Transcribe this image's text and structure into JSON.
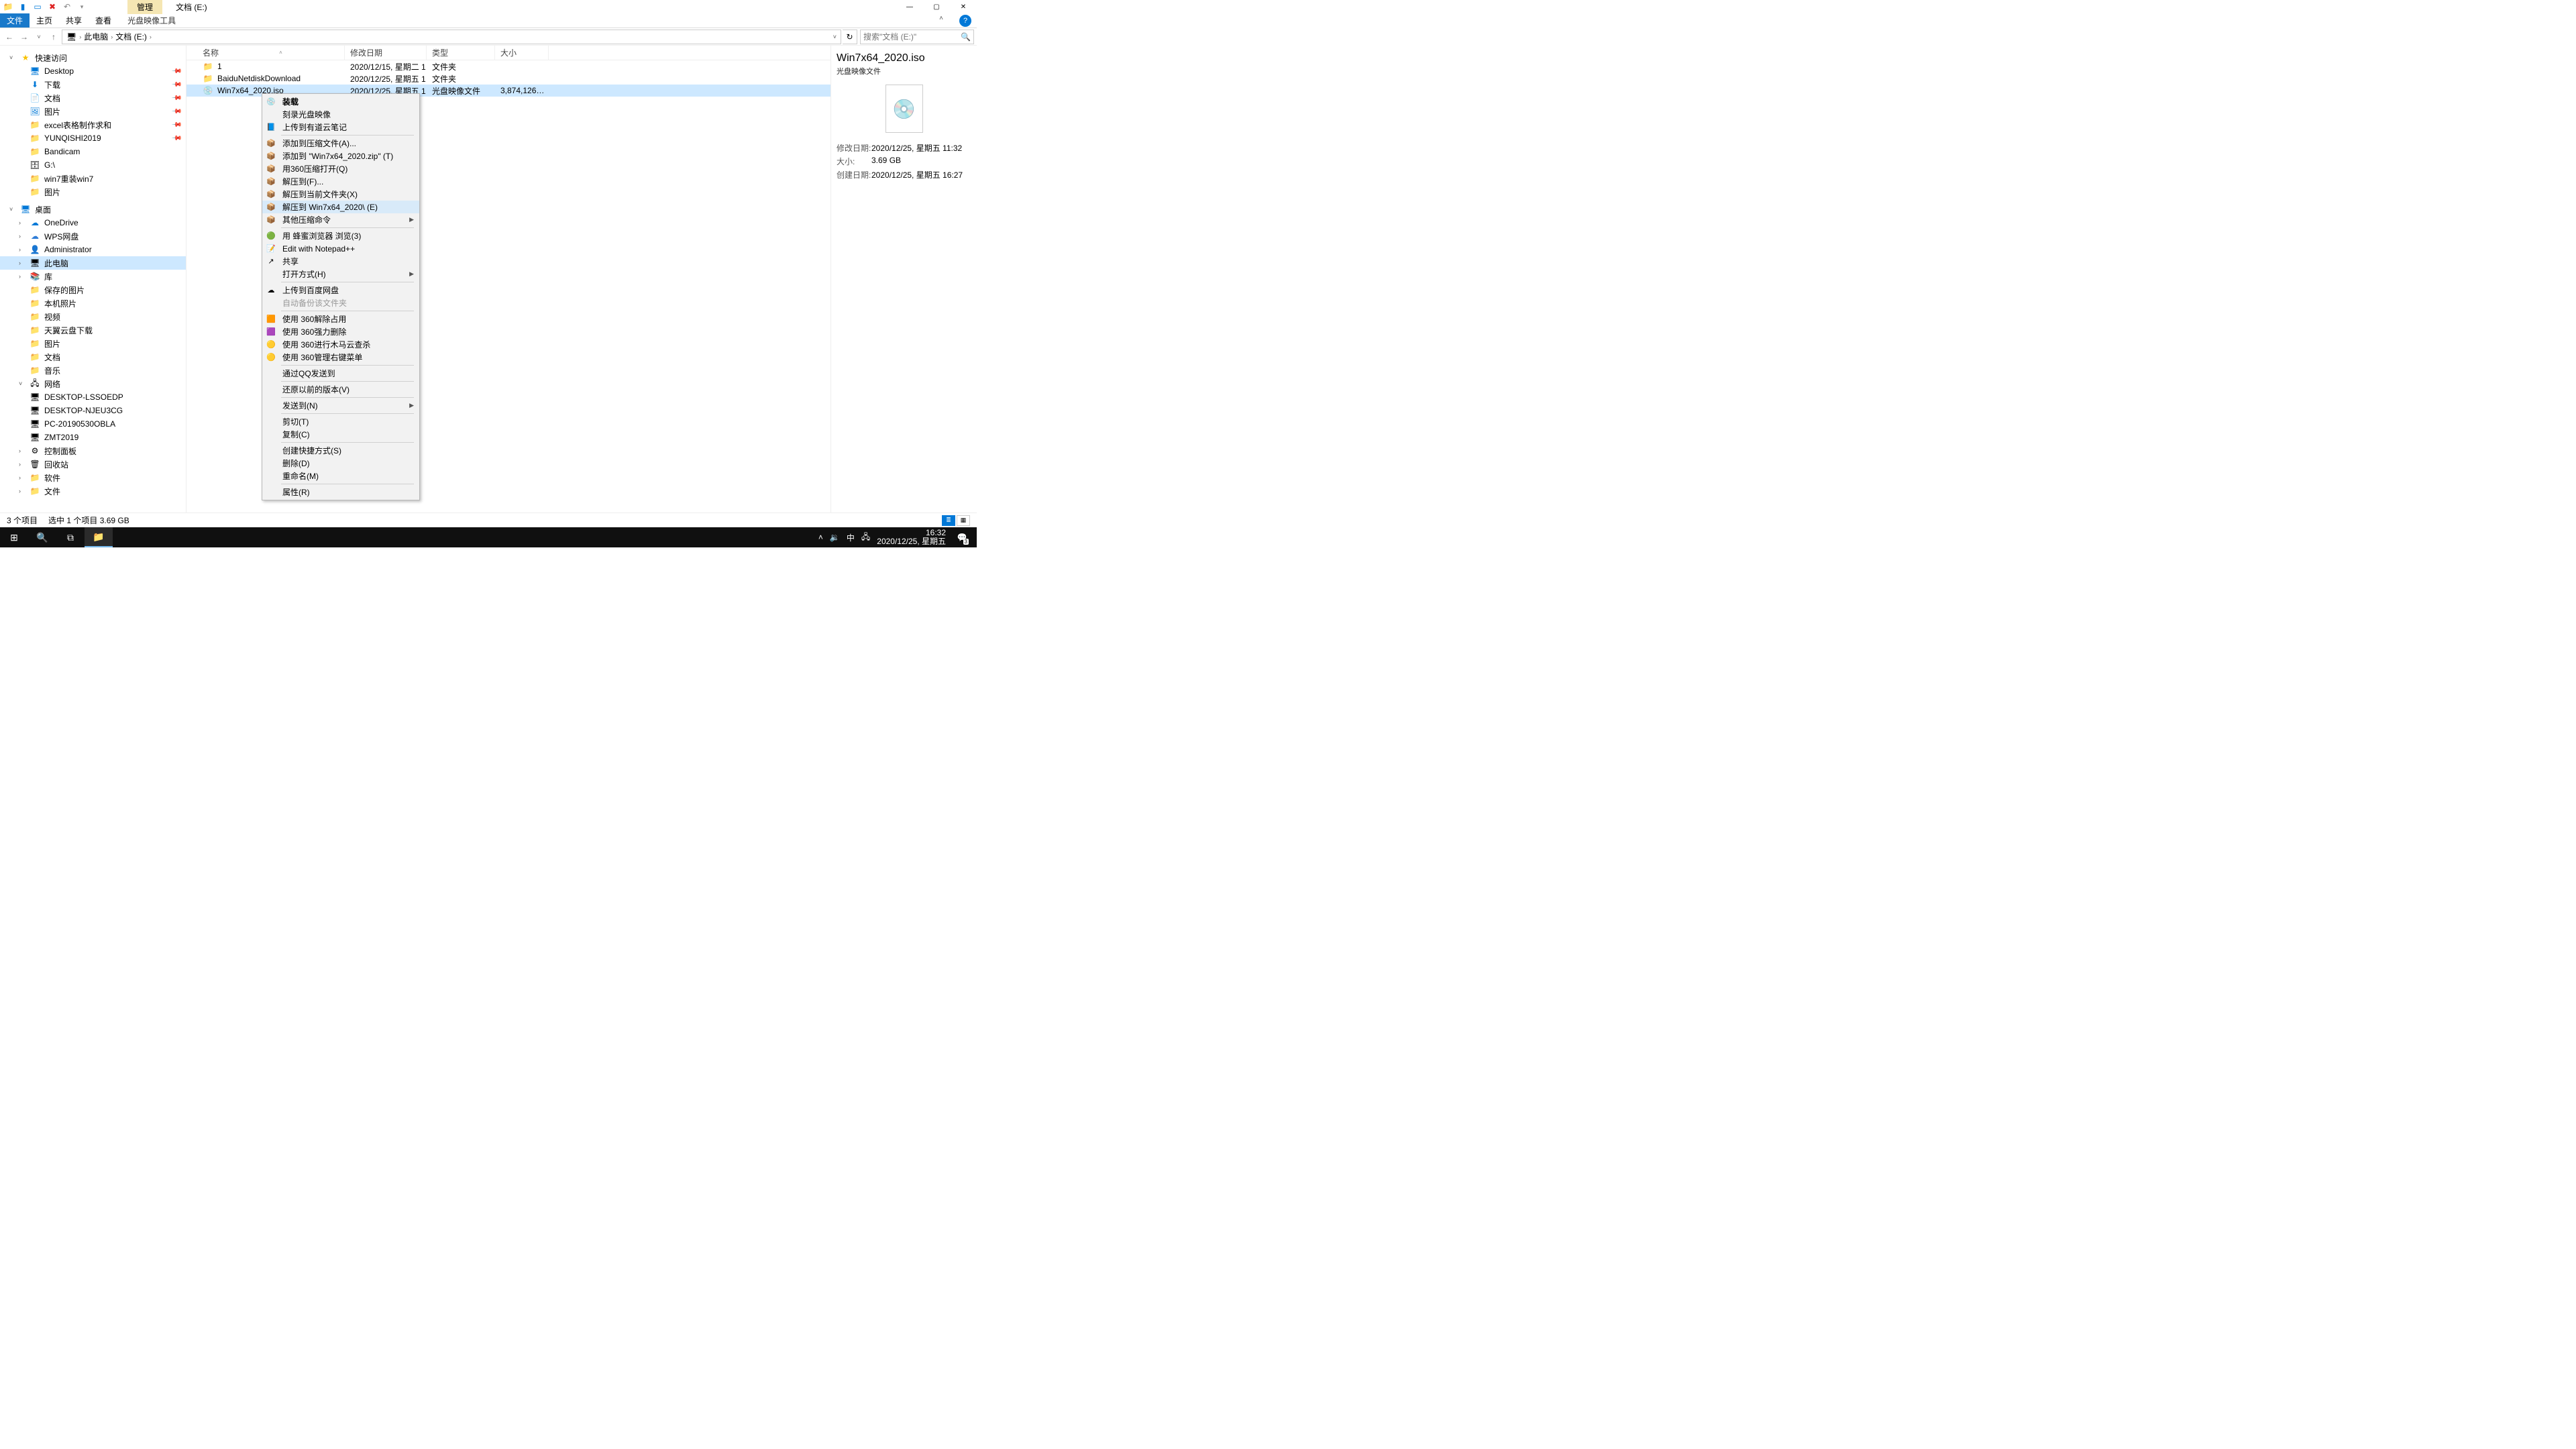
{
  "window": {
    "tab_context": "管理",
    "title": "文档 (E:)"
  },
  "ribbon": {
    "file": "文件",
    "home": "主页",
    "share": "共享",
    "view": "查看",
    "disc_tool": "光盘映像工具"
  },
  "address": {
    "root": "此电脑",
    "folder": "文档 (E:)",
    "search_placeholder": "搜索\"文档 (E:)\""
  },
  "columns": {
    "name": "名称",
    "date": "修改日期",
    "type": "类型",
    "size": "大小"
  },
  "rows": [
    {
      "icon": "folder",
      "name": "1",
      "date": "2020/12/15, 星期二 1…",
      "type": "文件夹",
      "size": ""
    },
    {
      "icon": "folder",
      "name": "BaiduNetdiskDownload",
      "date": "2020/12/25, 星期五 1…",
      "type": "文件夹",
      "size": ""
    },
    {
      "icon": "disc",
      "name": "Win7x64_2020.iso",
      "date": "2020/12/25, 星期五 1…",
      "type": "光盘映像文件",
      "size": "3,874,126…",
      "sel": true
    }
  ],
  "tree": {
    "quick": "快速访问",
    "quick_items": [
      {
        "ic": "i-desk",
        "t": "Desktop",
        "pin": true
      },
      {
        "ic": "i-dl",
        "t": "下载",
        "pin": true
      },
      {
        "ic": "i-doc",
        "t": "文档",
        "pin": true
      },
      {
        "ic": "i-pic",
        "t": "图片",
        "pin": true
      },
      {
        "ic": "i-folder",
        "t": "excel表格制作求和",
        "pin": true
      },
      {
        "ic": "i-folder",
        "t": "YUNQISHI2019",
        "pin": true
      },
      {
        "ic": "i-folder",
        "t": "Bandicam"
      },
      {
        "ic": "i-drv",
        "t": "G:\\"
      },
      {
        "ic": "i-folder",
        "t": "win7重装win7"
      },
      {
        "ic": "i-folder",
        "t": "图片"
      }
    ],
    "desktop": "桌面",
    "desktop_items": [
      {
        "ic": "i-one",
        "t": "OneDrive"
      },
      {
        "ic": "i-wps",
        "t": "WPS网盘"
      },
      {
        "ic": "i-user",
        "t": "Administrator"
      },
      {
        "ic": "i-pc",
        "t": "此电脑",
        "sel": true
      },
      {
        "ic": "i-lib",
        "t": "库"
      }
    ],
    "lib_items": [
      {
        "ic": "i-folder",
        "t": "保存的图片"
      },
      {
        "ic": "i-folder",
        "t": "本机照片"
      },
      {
        "ic": "i-folder",
        "t": "视频"
      },
      {
        "ic": "i-folder",
        "t": "天翼云盘下载"
      },
      {
        "ic": "i-folder",
        "t": "图片"
      },
      {
        "ic": "i-folder",
        "t": "文档"
      },
      {
        "ic": "i-folder",
        "t": "音乐"
      }
    ],
    "network": "网络",
    "net_items": [
      {
        "ic": "i-pc",
        "t": "DESKTOP-LSSOEDP"
      },
      {
        "ic": "i-pc",
        "t": "DESKTOP-NJEU3CG"
      },
      {
        "ic": "i-pc",
        "t": "PC-20190530OBLA"
      },
      {
        "ic": "i-pc",
        "t": "ZMT2019"
      }
    ],
    "tail": [
      {
        "ic": "i-panel",
        "t": "控制面板"
      },
      {
        "ic": "i-bin",
        "t": "回收站"
      },
      {
        "ic": "i-folder",
        "t": "软件"
      },
      {
        "ic": "i-folder",
        "t": "文件"
      }
    ]
  },
  "preview": {
    "name": "Win7x64_2020.iso",
    "type": "光盘映像文件",
    "k_mod": "修改日期:",
    "v_mod": "2020/12/25, 星期五 11:32",
    "k_size": "大小:",
    "v_size": "3.69 GB",
    "k_create": "创建日期:",
    "v_create": "2020/12/25, 星期五 16:27"
  },
  "status": {
    "count": "3 个项目",
    "sel": "选中 1 个项目  3.69 GB"
  },
  "ctx": [
    {
      "t": "装载",
      "ic": "💿",
      "bold": true
    },
    {
      "t": "刻录光盘映像"
    },
    {
      "t": "上传到有道云笔记",
      "ic": "📘"
    },
    {
      "sep": true
    },
    {
      "t": "添加到压缩文件(A)...",
      "ic": "📦"
    },
    {
      "t": "添加到 \"Win7x64_2020.zip\" (T)",
      "ic": "📦"
    },
    {
      "t": "用360压缩打开(Q)",
      "ic": "📦"
    },
    {
      "t": "解压到(F)...",
      "ic": "📦"
    },
    {
      "t": "解压到当前文件夹(X)",
      "ic": "📦"
    },
    {
      "t": "解压到 Win7x64_2020\\ (E)",
      "ic": "📦",
      "hov": true
    },
    {
      "t": "其他压缩命令",
      "ic": "📦",
      "sub": true
    },
    {
      "sep": true
    },
    {
      "t": "用 蜂蜜浏览器 浏览(3)",
      "ic": "🟢"
    },
    {
      "t": "Edit with Notepad++",
      "ic": "📝"
    },
    {
      "t": "共享",
      "ic": "↗"
    },
    {
      "t": "打开方式(H)",
      "sub": true
    },
    {
      "sep": true
    },
    {
      "t": "上传到百度网盘",
      "ic": "☁"
    },
    {
      "t": "自动备份该文件夹",
      "dis": true
    },
    {
      "sep": true
    },
    {
      "t": "使用 360解除占用",
      "ic": "🟧"
    },
    {
      "t": "使用 360强力删除",
      "ic": "🟪"
    },
    {
      "t": "使用 360进行木马云查杀",
      "ic": "🟡"
    },
    {
      "t": "使用 360管理右键菜单",
      "ic": "🟡"
    },
    {
      "sep": true
    },
    {
      "t": "通过QQ发送到"
    },
    {
      "sep": true
    },
    {
      "t": "还原以前的版本(V)"
    },
    {
      "sep": true
    },
    {
      "t": "发送到(N)",
      "sub": true
    },
    {
      "sep": true
    },
    {
      "t": "剪切(T)"
    },
    {
      "t": "复制(C)"
    },
    {
      "sep": true
    },
    {
      "t": "创建快捷方式(S)"
    },
    {
      "t": "删除(D)"
    },
    {
      "t": "重命名(M)"
    },
    {
      "sep": true
    },
    {
      "t": "属性(R)"
    }
  ],
  "taskbar": {
    "time": "16:32",
    "date": "2020/12/25, 星期五",
    "ime": "中",
    "notif_count": "3"
  }
}
